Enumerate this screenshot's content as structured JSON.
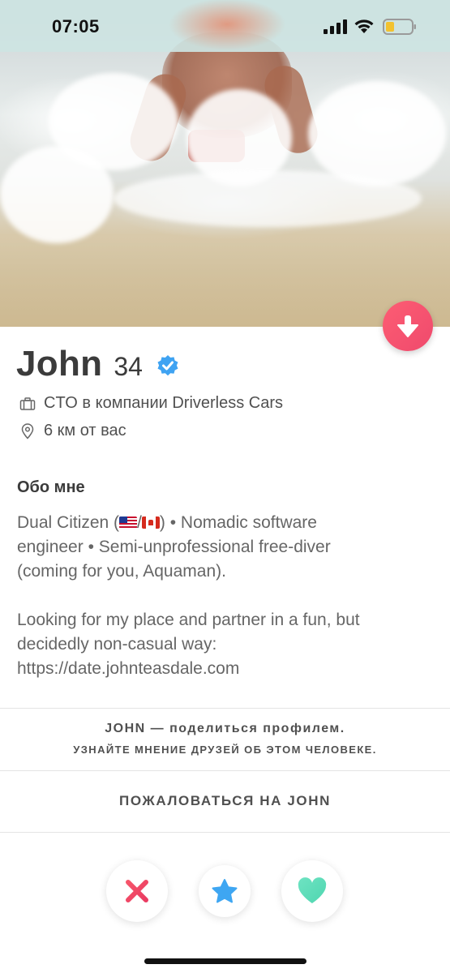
{
  "status_bar": {
    "time": "07:05"
  },
  "profile": {
    "name": "John",
    "age": "34",
    "job": "CTO в компании Driverless Cars",
    "distance": "6 км от вас"
  },
  "about": {
    "title": "Обо мне",
    "bio_line1_a": "Dual Citizen (",
    "bio_line1_sep": "/",
    "bio_line1_b": ") • Nomadic software",
    "bio_line2": "engineer • Semi-unprofessional free-diver",
    "bio_line3": "(coming for you, Aquaman).",
    "bio_line4": "Looking for my place and partner in a fun, but",
    "bio_line5": "decidedly non-casual way:",
    "bio_line6": "https://date.johnteasdale.com"
  },
  "share": {
    "title": "JOHN — поделиться профилем.",
    "subtitle": "УЗНАЙТЕ МНЕНИЕ ДРУЗЕЙ ОБ ЭТОМ ЧЕЛОВЕКЕ."
  },
  "report": {
    "label": "ПОЖАЛОВАТЬСЯ НА JOHN"
  },
  "icons": {
    "down": "arrow-down-icon",
    "verified": "verified-badge-icon",
    "job": "briefcase-icon",
    "distance": "location-pin-icon",
    "nope": "x-icon",
    "superlike": "star-icon",
    "like": "heart-icon"
  },
  "colors": {
    "accent": "#fd5d73",
    "verified": "#3fa3f2",
    "nope": "#f0495e",
    "superlike": "#3ea6f2",
    "like": "#5ee0b8"
  }
}
